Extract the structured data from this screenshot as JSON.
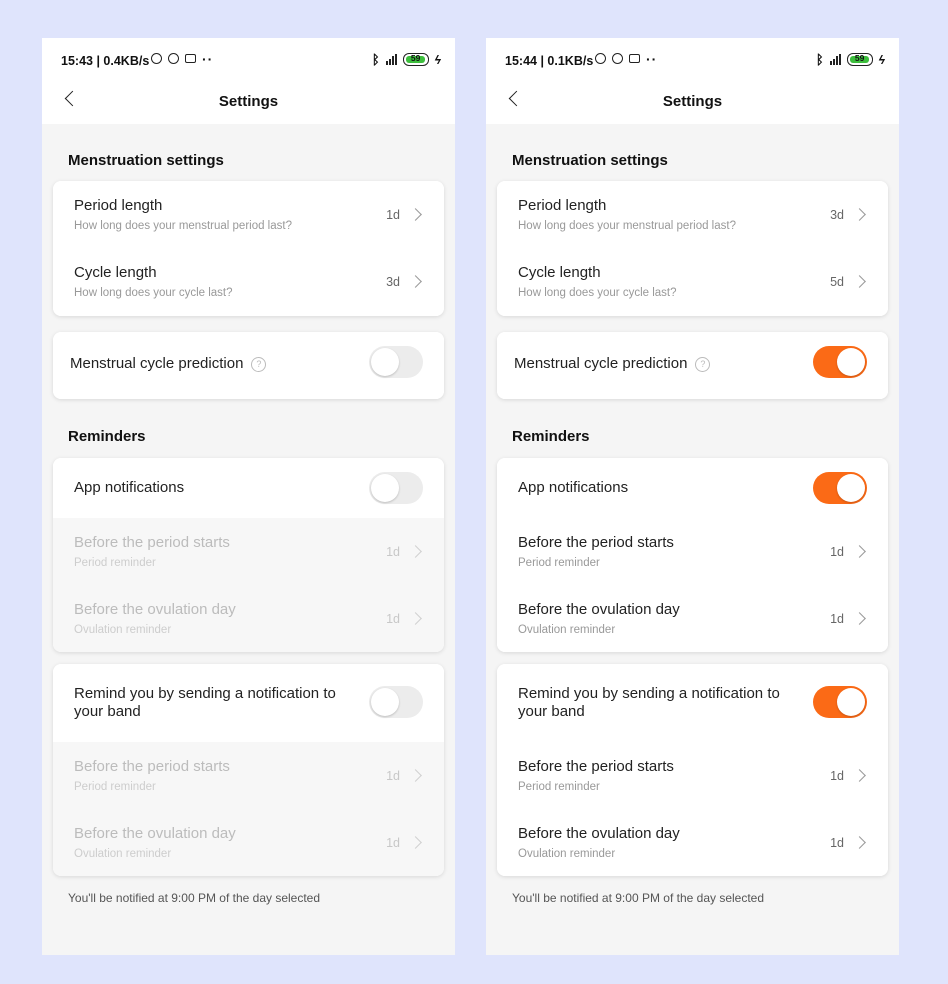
{
  "screens": [
    {
      "status_time": "15:43 | 0.4KB/s",
      "battery": "59",
      "nav_title": "Settings",
      "menstruation_title": "Menstruation settings",
      "period_label": "Period length",
      "period_sub": "How long does your menstrual period last?",
      "period_value": "1d",
      "cycle_label": "Cycle length",
      "cycle_sub": "How long does your cycle last?",
      "cycle_value": "3d",
      "prediction_label": "Menstrual cycle prediction",
      "prediction_on": false,
      "reminders_title": "Reminders",
      "app_notif_label": "App notifications",
      "app_notif_on": false,
      "app_before_period_label": "Before the period starts",
      "app_before_period_sub": "Period reminder",
      "app_before_period_value": "1d",
      "app_before_ovulation_label": "Before the ovulation day",
      "app_before_ovulation_sub": "Ovulation reminder",
      "app_before_ovulation_value": "1d",
      "band_label": "Remind you by sending a notification to your band",
      "band_on": false,
      "band_before_period_label": "Before the period starts",
      "band_before_period_sub": "Period reminder",
      "band_before_period_value": "1d",
      "band_before_ovulation_label": "Before the ovulation day",
      "band_before_ovulation_sub": "Ovulation reminder",
      "band_before_ovulation_value": "1d",
      "footer": "You'll be notified at 9:00 PM of the day selected"
    },
    {
      "status_time": "15:44 | 0.1KB/s",
      "battery": "59",
      "nav_title": "Settings",
      "menstruation_title": "Menstruation settings",
      "period_label": "Period length",
      "period_sub": "How long does your menstrual period last?",
      "period_value": "3d",
      "cycle_label": "Cycle length",
      "cycle_sub": "How long does your cycle last?",
      "cycle_value": "5d",
      "prediction_label": "Menstrual cycle prediction",
      "prediction_on": true,
      "reminders_title": "Reminders",
      "app_notif_label": "App notifications",
      "app_notif_on": true,
      "app_before_period_label": "Before the period starts",
      "app_before_period_sub": "Period reminder",
      "app_before_period_value": "1d",
      "app_before_ovulation_label": "Before the ovulation day",
      "app_before_ovulation_sub": "Ovulation reminder",
      "app_before_ovulation_value": "1d",
      "band_label": "Remind you by sending a notification to your band",
      "band_on": true,
      "band_before_period_label": "Before the period starts",
      "band_before_period_sub": "Period reminder",
      "band_before_period_value": "1d",
      "band_before_ovulation_label": "Before the ovulation day",
      "band_before_ovulation_sub": "Ovulation reminder",
      "band_before_ovulation_value": "1d",
      "footer": "You'll be notified at 9:00 PM of the day selected"
    }
  ],
  "colors": {
    "accent": "#fb6a16",
    "background": "#dfe4fc",
    "toggle_off": "#ececec"
  }
}
